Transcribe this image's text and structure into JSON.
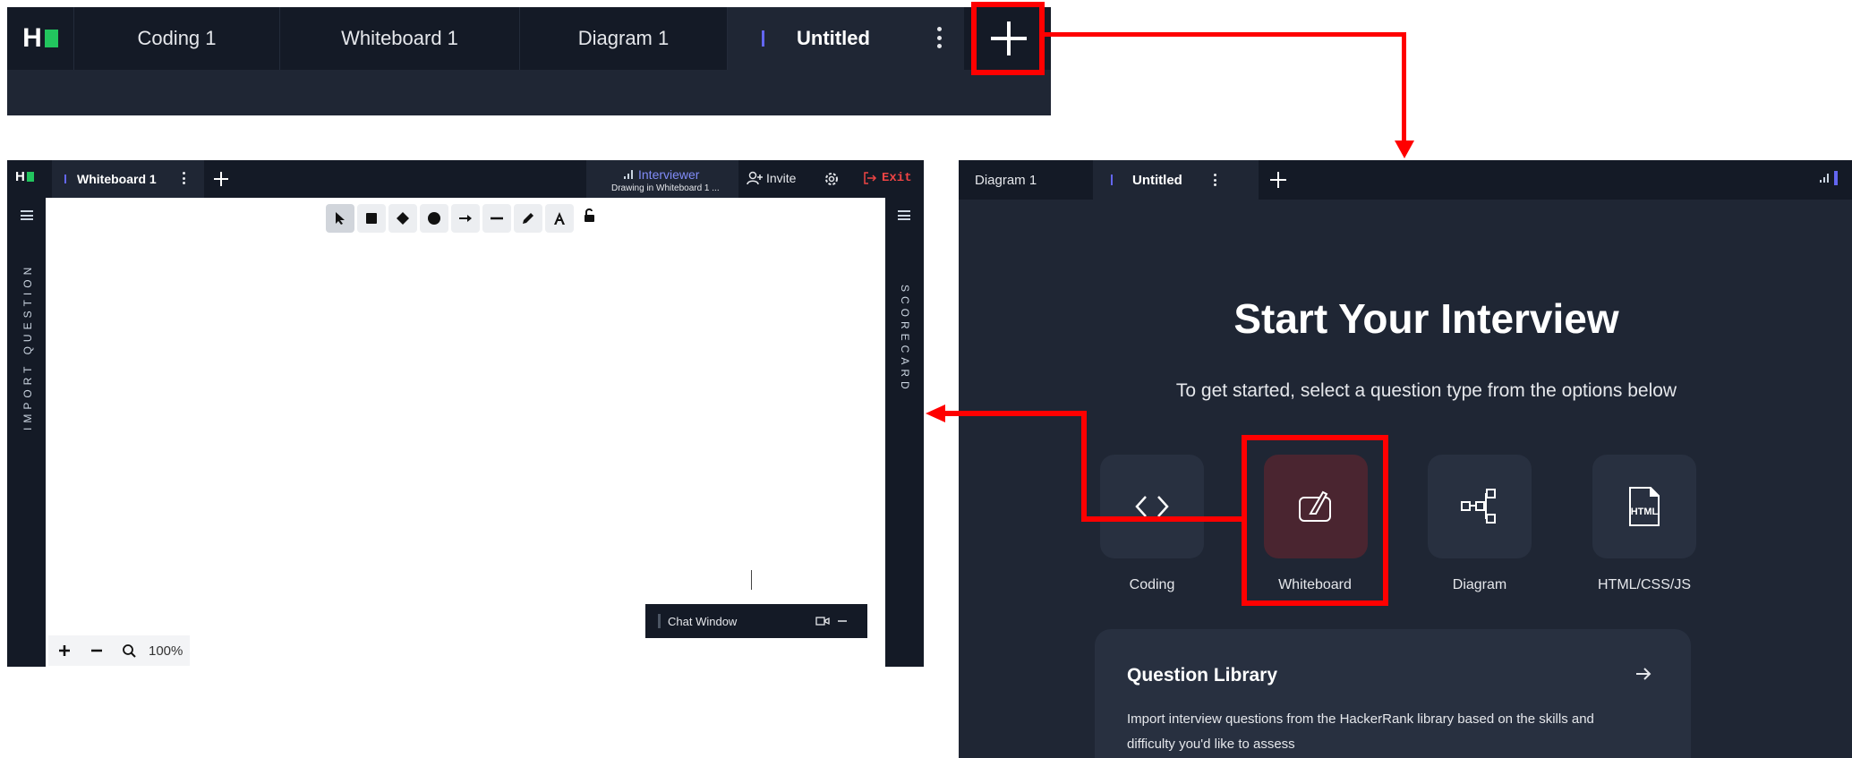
{
  "top_bar": {
    "logo_text": "H",
    "tabs": [
      {
        "label": "Coding 1"
      },
      {
        "label": "Whiteboard 1"
      },
      {
        "label": "Diagram 1"
      },
      {
        "label": "Untitled",
        "active": true
      }
    ]
  },
  "whiteboard": {
    "logo_text": "H",
    "tab_label": "Whiteboard 1",
    "interviewer_label": "Interviewer",
    "interviewer_status": "Drawing in Whiteboard 1 ...",
    "invite_label": "Invite",
    "exit_label": "Exit",
    "left_rail_label": "IMPORT QUESTION",
    "right_rail_label": "SCORECARD",
    "toolbar": [
      {
        "icon": "cursor-icon",
        "num": "1"
      },
      {
        "icon": "rectangle-icon",
        "num": "2"
      },
      {
        "icon": "diamond-icon",
        "num": "3"
      },
      {
        "icon": "circle-icon",
        "num": "4"
      },
      {
        "icon": "arrow-icon",
        "num": "5"
      },
      {
        "icon": "line-icon",
        "num": "6"
      },
      {
        "icon": "pencil-icon",
        "num": "7"
      },
      {
        "icon": "text-icon",
        "num": "8"
      },
      {
        "icon": "lock-icon",
        "num": ""
      }
    ],
    "chat_label": "Chat Window",
    "zoom_level": "100%"
  },
  "start_interview": {
    "tabs": [
      {
        "label": "Diagram 1"
      },
      {
        "label": "Untitled",
        "active": true
      }
    ],
    "title": "Start Your Interview",
    "subtitle": "To get started, select a question type from the options below",
    "options": [
      {
        "label": "Coding",
        "icon": "code-icon"
      },
      {
        "label": "Whiteboard",
        "icon": "whiteboard-icon",
        "highlighted": true
      },
      {
        "label": "Diagram",
        "icon": "diagram-icon"
      },
      {
        "label": "HTML/CSS/JS",
        "icon": "html-file-icon"
      }
    ],
    "library": {
      "title": "Question Library",
      "description": "Import interview questions from the HackerRank library based on the skills and difficulty you'd like to assess"
    }
  },
  "colors": {
    "dark_bg": "#141a26",
    "panel_bg": "#1f2634",
    "annotation": "#ff0000",
    "accent": "#6366f1",
    "brand_green": "#22c55e",
    "exit": "#ef4444"
  }
}
